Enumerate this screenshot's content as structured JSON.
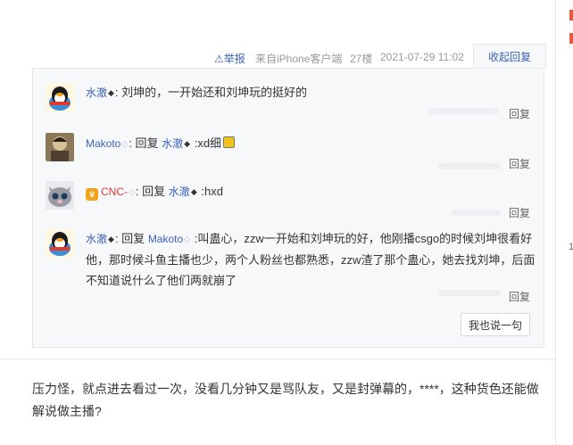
{
  "post_tail": {
    "report_label": "举报",
    "client_label": "来自iPhone客户端",
    "floor_label": "27楼",
    "time_label": "2021-07-29 11:02"
  },
  "fold_label": "收起回复",
  "replies": [
    {
      "user": "水澈",
      "text": "刘坤的，一开始还和刘坤玩的挺好的",
      "reply_label": "回复"
    },
    {
      "user": "Makoto",
      "reply_word": "回复",
      "target": "水澈",
      "text": ":xd细",
      "reply_label": "回复"
    },
    {
      "user": "CNC-",
      "reply_word": "回复",
      "target": "水澈",
      "text": ":hxd",
      "reply_label": "回复"
    },
    {
      "user": "水澈",
      "reply_word": "回复",
      "target": "Makoto",
      "text": ":叫蛊心，zzw一开始和刘坤玩的好，他刚播csgo的时候刘坤很看好他，那时候斗鱼主播也少，两个人粉丝也都熟悉，zzw渣了那个蛊心，她去找刘坤，后面不知道说什么了他们两就崩了",
      "reply_label": "回复"
    }
  ],
  "say_button_label": "我也说一句",
  "next_post_text": "压力怪，就点进去看过一次，没看几分钟又是骂队友，又是封弹幕的，****，这种货色还能做解说做主播?",
  "right_edge_number": "1",
  "colors": {
    "link": "#3d63b8",
    "panel_bg": "#f7f8fa",
    "accent_red": "#e85a3c"
  }
}
